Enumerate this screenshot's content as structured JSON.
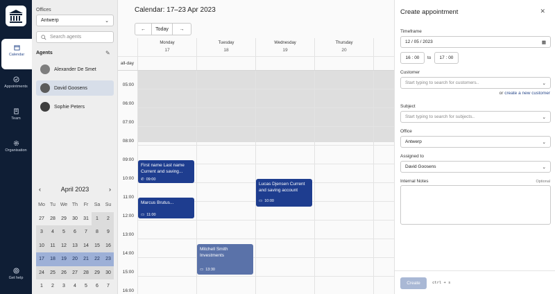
{
  "nav": {
    "items": [
      {
        "label": "Calendar"
      },
      {
        "label": "Appointments"
      },
      {
        "label": "Team"
      },
      {
        "label": "Organisation"
      },
      {
        "label": "Get help"
      }
    ]
  },
  "sidebar": {
    "offices_label": "Offices",
    "office_value": "Antwerp",
    "search_placeholder": "Search agents",
    "agents_label": "Agents",
    "agents": [
      {
        "first": "Alexander",
        "last": "De Smet"
      },
      {
        "first": "David",
        "last": "Goosens"
      },
      {
        "first": "Sophie",
        "last": "Peters"
      }
    ],
    "month": "April 2023",
    "weekdays": [
      "Mo",
      "Tu",
      "We",
      "Th",
      "Fr",
      "Sa",
      "Su"
    ],
    "weeks": [
      [
        "27",
        "28",
        "29",
        "30",
        "31",
        "1",
        "2"
      ],
      [
        "3",
        "4",
        "5",
        "6",
        "7",
        "8",
        "9"
      ],
      [
        "10",
        "11",
        "12",
        "13",
        "14",
        "15",
        "16"
      ],
      [
        "17",
        "18",
        "19",
        "20",
        "21",
        "22",
        "23"
      ],
      [
        "24",
        "25",
        "26",
        "27",
        "28",
        "29",
        "30"
      ],
      [
        "1",
        "2",
        "3",
        "4",
        "5",
        "6",
        "7"
      ]
    ]
  },
  "main": {
    "title": "Calendar: 17–23 Apr 2023",
    "today_label": "Today",
    "days": [
      {
        "name": "Monday",
        "num": "17"
      },
      {
        "name": "Tuesday",
        "num": "18"
      },
      {
        "name": "Wednesday",
        "num": "19"
      },
      {
        "name": "Thursday",
        "num": "20"
      }
    ],
    "allday": "all-day",
    "hours": [
      "05:00",
      "06:00",
      "07:00",
      "08:00",
      "09:00",
      "10:00",
      "11:00",
      "12:00",
      "13:00",
      "14:00",
      "15:00",
      "16:00"
    ],
    "events": [
      {
        "title": "First name Last name Current and saving...",
        "time": "09:00"
      },
      {
        "title": "Marcus Brutus...",
        "time": "11:00"
      },
      {
        "title": "Lucas Djensen Current and saving account",
        "time": "10:00"
      },
      {
        "title": "Mitchell Smith Investments",
        "time": "13:30"
      }
    ]
  },
  "panel": {
    "title": "Create appointment",
    "timeframe_label": "Timeframe",
    "date": "12 / 05 / 2023",
    "start": "16 : 00",
    "to": "to",
    "end": "17 : 00",
    "customer_label": "Customer",
    "customer_placeholder": "Start typing to search for customers..",
    "or_text": "or",
    "create_customer": "create a new customer",
    "subject_label": "Subject",
    "subject_placeholder": "Start typing to search for subjects..",
    "office_label": "Office",
    "office_value": "Antwerp",
    "assigned_label": "Assigned to",
    "assigned_value": "David Goosens",
    "notes_label": "Internal Notes",
    "optional": "Optional",
    "create_label": "Create",
    "shortcut": "ctrl + s"
  },
  "colors": {
    "rail": "#0f1e35",
    "event_dark": "#1e3d8f",
    "event_light": "#5a72a9"
  }
}
